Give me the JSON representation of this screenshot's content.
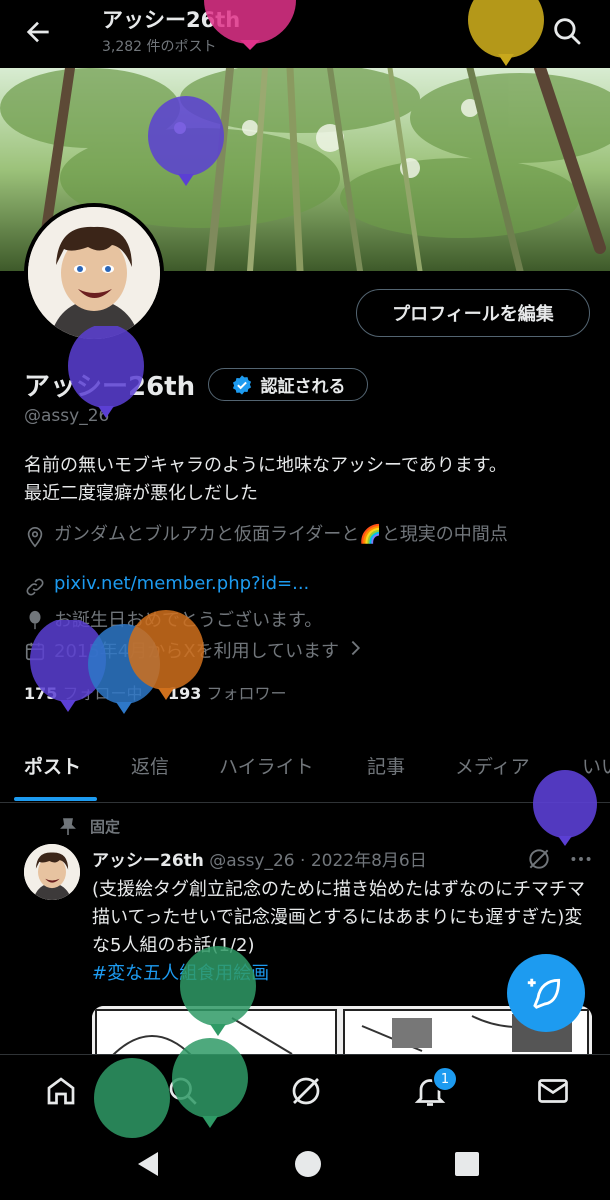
{
  "header": {
    "title": "アッシー26th",
    "post_count": "3,282 件のポスト"
  },
  "profile": {
    "edit_button": "プロフィールを編集",
    "name": "アッシー26th",
    "verify_label": "認証される",
    "handle": "@assy_26",
    "bio_line1": "名前の無いモブキャラのように地味なアッシーであります。",
    "bio_line2": "最近二度寝癖が悪化しだした",
    "location": "ガンダムとブルアカと仮面ライダーと🌈と現実の中間点",
    "link": "pixiv.net/member.php?id=...",
    "birthday": "お誕生日おめでとうございます。",
    "joined": "2015年4月からXを利用しています",
    "following_count": "175",
    "following_label": "フォロー中",
    "followers_count": "193",
    "followers_label": "フォロワー"
  },
  "tabs": [
    {
      "label": "ポスト"
    },
    {
      "label": "返信"
    },
    {
      "label": "ハイライト"
    },
    {
      "label": "記事"
    },
    {
      "label": "メディア"
    },
    {
      "label": "いいね"
    }
  ],
  "tweet": {
    "pinned_label": "固定",
    "author": "アッシー26th",
    "handle": "@assy_26",
    "date": "· 2022年8月6日",
    "text": "(支援絵タグ創立記念のために描き始めたはずなのにチマチマ描いてったせいで記念漫画とするにはあまりにも遅すぎた)変な5人組のお話(1/2)",
    "hashtag": "#変な五人組食用絵画"
  },
  "bottom_nav": {
    "notification_badge": "1",
    "items": [
      "home-icon",
      "search-icon",
      "grok-icon",
      "bell-icon",
      "mail-icon"
    ]
  },
  "colors": {
    "accent": "#1d9bf0",
    "background": "#000000",
    "text": "#e7e9ea",
    "muted": "#71767b"
  }
}
